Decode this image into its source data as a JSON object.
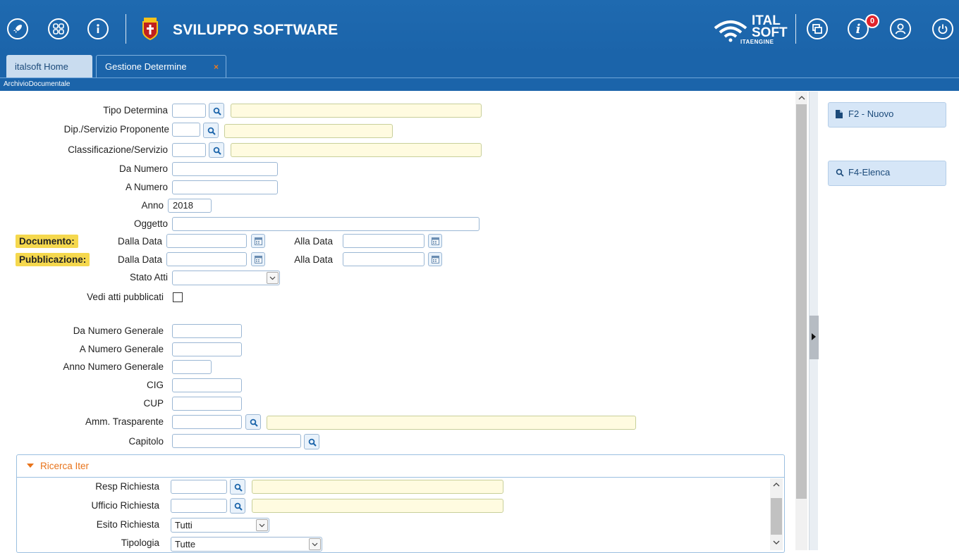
{
  "header": {
    "title": "SVILUPPO SOFTWARE",
    "logo_line1": "ITAL",
    "logo_line2": "SOFT",
    "logo_line3": "ITAENGINE",
    "notification_count": "0",
    "icons": [
      "rocket-icon",
      "apps-grid-icon",
      "info-menu-icon",
      "windows-icon",
      "info-icon",
      "user-icon",
      "power-icon"
    ]
  },
  "tabs": [
    {
      "label": "italsoft Home",
      "active": false
    },
    {
      "label": "Gestione Determine",
      "active": true,
      "close": "×"
    }
  ],
  "breadcrumb": "ArchivioDocumentale",
  "form": {
    "tipo_determina": "Tipo Determina",
    "dip_servizio": "Dip./Servizio Proponente",
    "classificazione": "Classificazione/Servizio",
    "da_numero": "Da Numero",
    "a_numero": "A Numero",
    "anno": "Anno",
    "anno_value": "2018",
    "oggetto": "Oggetto",
    "documento": "Documento:",
    "pubblicazione": "Pubblicazione:",
    "dalla_data": "Dalla Data",
    "alla_data": "Alla Data",
    "stato_atti": "Stato Atti",
    "vedi_atti": "Vedi atti pubblicati",
    "da_numero_generale": "Da Numero Generale",
    "a_numero_generale": "A Numero Generale",
    "anno_numero_generale": "Anno Numero Generale",
    "cig": "CIG",
    "cup": "CUP",
    "amm_trasparente": "Amm. Trasparente",
    "capitolo": "Capitolo"
  },
  "iter": {
    "title": "Ricerca Iter",
    "resp_richiesta": "Resp Richiesta",
    "ufficio_richiesta": "Ufficio Richiesta",
    "esito_richiesta": "Esito Richiesta",
    "esito_value": "Tutti",
    "tipologia": "Tipologia",
    "tipologia_value": "Tutte"
  },
  "actions": {
    "nuovo": "F2 - Nuovo",
    "elenca": "F4-Elenca"
  },
  "colors": {
    "header_blue": "#1b64aa",
    "yellow_field": "#fffbe0",
    "highlight_label": "#f5d84e",
    "legend_orange": "#e8731a",
    "badge_red": "#e2242c"
  }
}
